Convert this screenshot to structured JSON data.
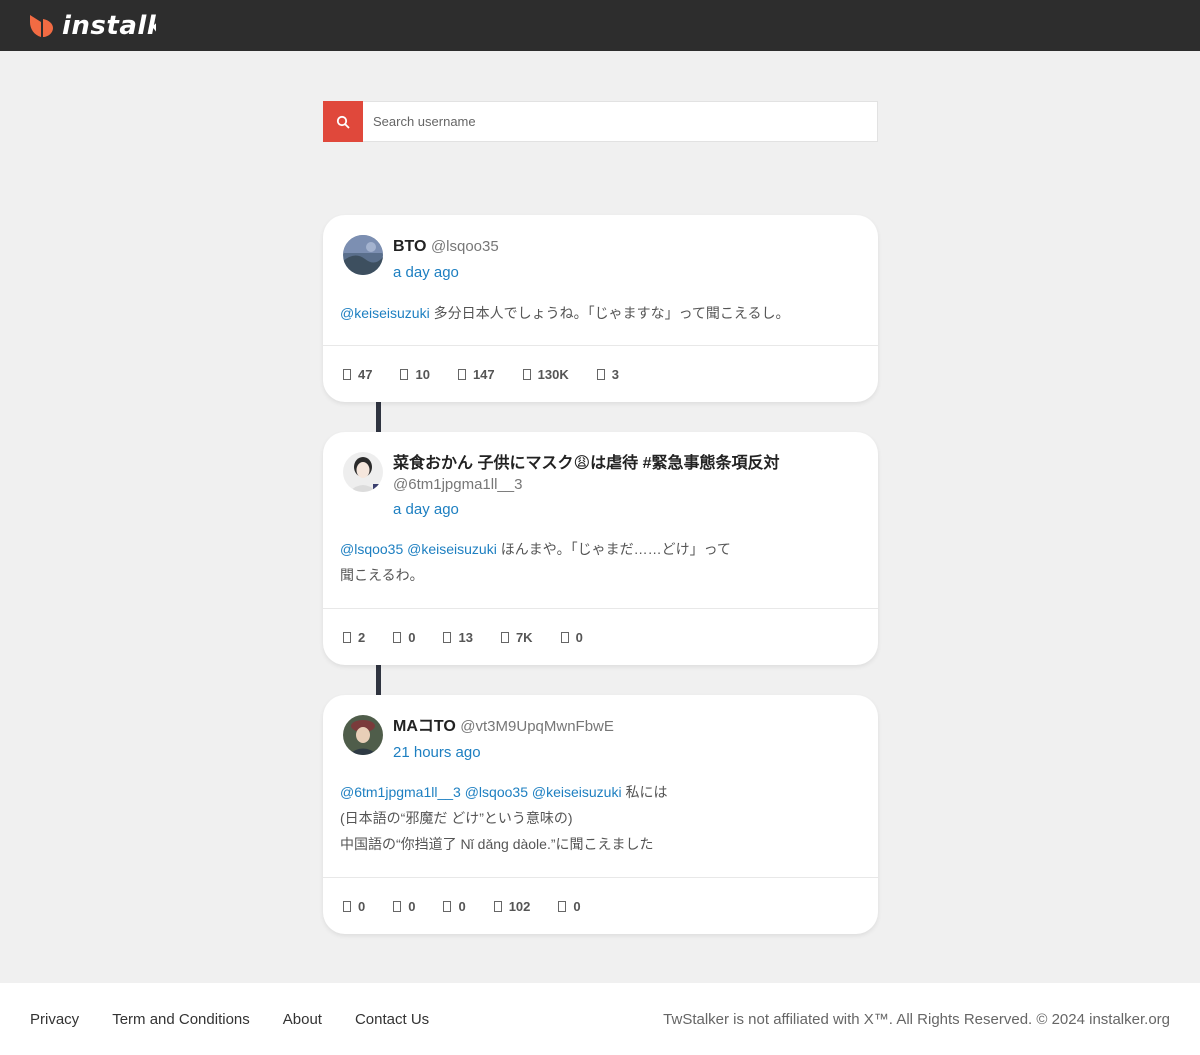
{
  "header": {
    "logo_text": "instalker"
  },
  "search": {
    "placeholder": "Search username"
  },
  "posts": [
    {
      "display_name": "BTO",
      "handle": "@lsqoo35",
      "time": "a day ago",
      "mentions": "@keiseisuzuki",
      "lines": [
        "多分日本人でしょうね。「じゃますな」って聞こえるし。"
      ],
      "stats": [
        "47",
        "10",
        "147",
        "130K",
        "3"
      ]
    },
    {
      "display_name": "菜食おかん 子供にマスク😩は虐待 #緊急事態条項反対",
      "handle": "@6tm1jpgma1ll__3",
      "time": "a day ago",
      "mentions": "@lsqoo35 @keiseisuzuki",
      "lines": [
        "ほんまや。「じゃまだ……どけ」って",
        "聞こえるわ。"
      ],
      "stats": [
        "2",
        "0",
        "13",
        "7K",
        "0"
      ]
    },
    {
      "display_name": "MAコTO",
      "handle": "@vt3M9UpqMwnFbwE",
      "time": "21 hours ago",
      "mentions": "@6tm1jpgma1ll__3 @lsqoo35 @keiseisuzuki",
      "lines": [
        "私には",
        "(日本語の“邪魔だ どけ”という意味の)",
        "中国語の“你挡道了 Nǐ dǎng dàole.”に聞こえました"
      ],
      "stats": [
        "0",
        "0",
        "0",
        "102",
        "0"
      ]
    }
  ],
  "footer": {
    "links": [
      "Privacy",
      "Term and Conditions",
      "About",
      "Contact Us"
    ],
    "note": "TwStalker is not affiliated with X™. All Rights Reserved. © 2024 instalker.org"
  },
  "colors": {
    "topbar": "#2d2d2d",
    "search_button": "#e0483b",
    "link": "#1d7fc1",
    "background": "#f0f0f0"
  },
  "icons": {
    "logo": "instalker-logo-icon",
    "search": "search-icon",
    "stats": [
      "reply-icon",
      "retweet-icon",
      "like-icon",
      "views-icon",
      "bookmark-icon"
    ]
  }
}
